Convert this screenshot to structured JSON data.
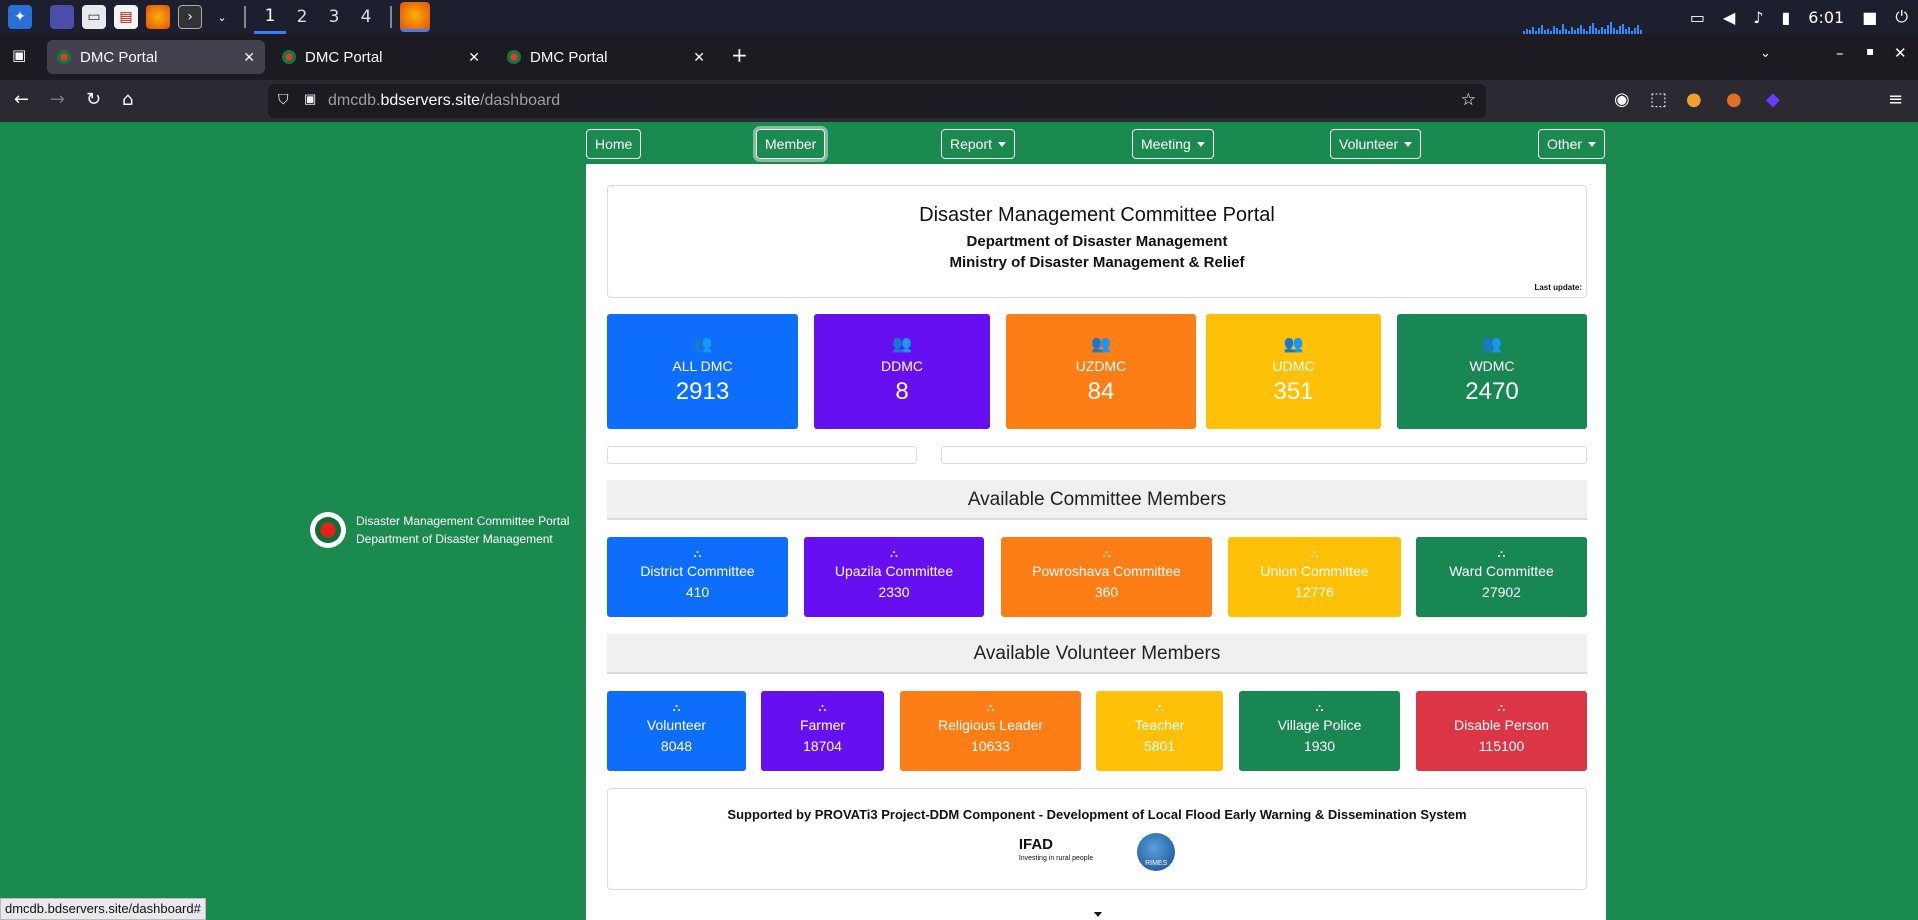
{
  "taskbar": {
    "workspaces": [
      "1",
      "2",
      "3",
      "4"
    ],
    "clock": "6:01",
    "icons": [
      "app-menu-icon",
      "desktop-icon",
      "files-icon",
      "pdf-icon",
      "firefox-icon",
      "terminal-icon",
      "chevron-down-icon",
      "firefox-window-icon"
    ],
    "tray_icons": [
      "screen-icon",
      "volume-icon",
      "bell-icon",
      "battery-icon",
      "lock-icon",
      "power-icon"
    ]
  },
  "browser": {
    "tabs": [
      {
        "title": "DMC Portal",
        "active": true
      },
      {
        "title": "DMC Portal",
        "active": false
      },
      {
        "title": "DMC Portal",
        "active": false
      }
    ],
    "url_host_prefix": "dmcdb.",
    "url_host": "bdservers.site",
    "url_path": "/dashboard",
    "status_url": "dmcdb.bdservers.site/dashboard#"
  },
  "sidebar": {
    "line1": "Disaster Management Committee Portal",
    "line2": "Department of Disaster Management"
  },
  "nav": {
    "home": "Home",
    "member": "Member",
    "report": "Report",
    "meeting": "Meeting",
    "volunteer": "Volunteer",
    "other": "Other"
  },
  "header": {
    "title": "Disaster Management Committee Portal",
    "dept": "Department of Disaster Management",
    "ministry": "Ministry of Disaster Management & Relief",
    "last_update": "Last update:"
  },
  "stats": [
    {
      "label": "ALL DMC",
      "value": "2913",
      "color": "#0d6efd"
    },
    {
      "label": "DDMC",
      "value": "8",
      "color": "#6610f2"
    },
    {
      "label": "UZDMC",
      "value": "84",
      "color": "#fd7e14"
    },
    {
      "label": "UDMC",
      "value": "351",
      "color": "#ffc107"
    },
    {
      "label": "WDMC",
      "value": "2470",
      "color": "#198754"
    }
  ],
  "committee": {
    "title": "Available Committee Members",
    "items": [
      {
        "label": "District Committee",
        "value": "410"
      },
      {
        "label": "Upazila Committee",
        "value": "2330"
      },
      {
        "label": "Powroshava Committee",
        "value": "360"
      },
      {
        "label": "Union Committee",
        "value": "12776"
      },
      {
        "label": "Ward Committee",
        "value": "27902"
      }
    ]
  },
  "volunteer": {
    "title": "Available Volunteer Members",
    "items": [
      {
        "label": "Volunteer",
        "value": "8048"
      },
      {
        "label": "Farmer",
        "value": "18704"
      },
      {
        "label": "Religious Leader",
        "value": "10633"
      },
      {
        "label": "Teacher",
        "value": "5801"
      },
      {
        "label": "Village Police",
        "value": "1930"
      },
      {
        "label": "Disable Person",
        "value": "115100"
      }
    ]
  },
  "support": {
    "text": "Supported by PROVATi3 Project-DDM Component - Development of Local Flood Early Warning & Dissemination System",
    "ifad": "IFAD",
    "ifad_tagline": "Investing in rural people",
    "rimes": "RIMES"
  }
}
